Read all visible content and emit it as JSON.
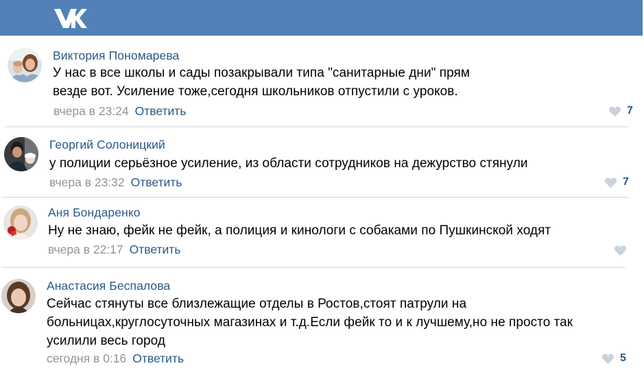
{
  "header": {
    "logo_icon": "vk-logo-icon",
    "background": "#5181b8"
  },
  "colors": {
    "name": "#2a5885",
    "meta": "#939393",
    "like_icon": "#cad2db",
    "separator": "#e7e8ec"
  },
  "comments": [
    {
      "author": "Виктория Пономарева",
      "text_lines": [
        "У нас в все школы и сады позакрывали типа \"санитарные дни\" прям",
        "везде вот. Усиление тоже,сегодня школьников отпустили с уроков."
      ],
      "time": "вчера в 23:24",
      "reply_label": "Ответить",
      "likes": "7"
    },
    {
      "author": "Георгий Солоницкий",
      "text_lines": [
        "у полиции серьёзное усиление, из области сотрудников на дежурство стянули"
      ],
      "time": "вчера в 23:32",
      "reply_label": "Ответить",
      "likes": "7"
    },
    {
      "author": "Аня Бондаренко",
      "text_lines": [
        "Ну не знаю, фейк не фейк, а полиция и кинологи с собаками по Пушкинской ходят"
      ],
      "time": "вчера в 22:17",
      "reply_label": "Ответить",
      "likes": ""
    },
    {
      "author": "Анастасия Беспалова",
      "text_lines": [
        "Сейчас стянуты все близлежащие отделы в Ростов,стоят патрули на",
        "больницах,круглосуточных магазинах и т.д.Если фейк то и к лучшему,но не просто так",
        "усилили весь город"
      ],
      "time": "сегодня в 0:16",
      "reply_label": "Ответить",
      "likes": "5"
    }
  ]
}
